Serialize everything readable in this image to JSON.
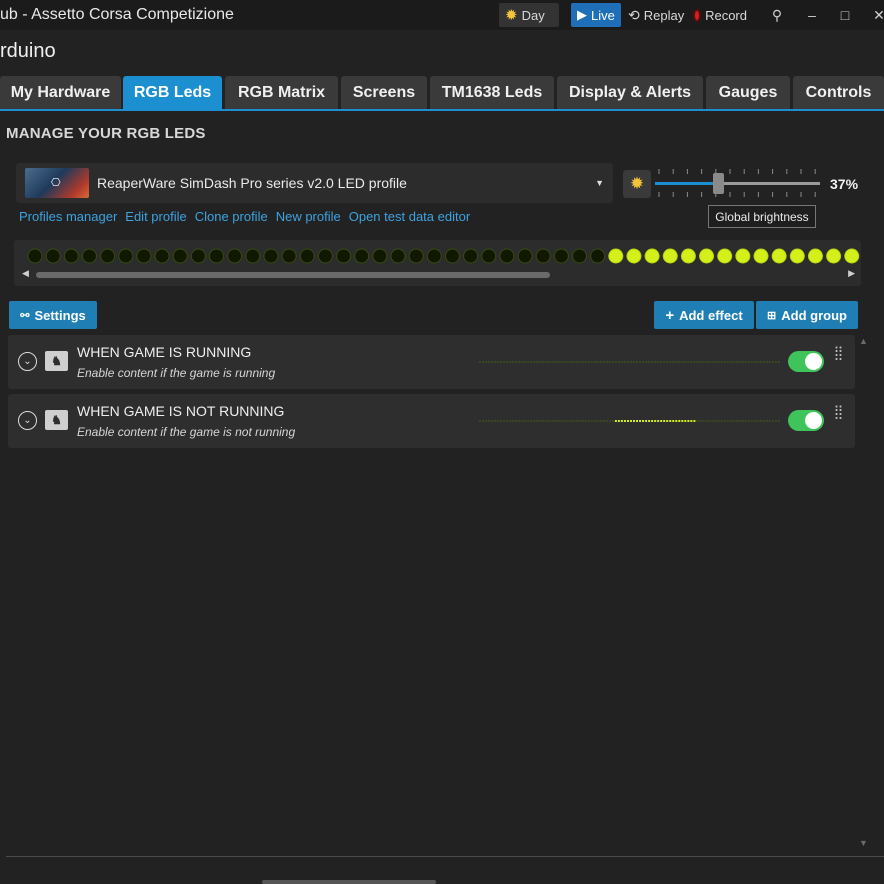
{
  "app": {
    "title": "ub - Assetto Corsa Competizione",
    "device": "rduino"
  },
  "toolbar": {
    "day_label": "Day",
    "live_label": "Live",
    "replay_label": "Replay",
    "record_label": "Record",
    "colors": {
      "live_bg": "#1f6fb8",
      "record_dot": "#d62020",
      "sun": "#f3c43c"
    }
  },
  "tabs": [
    {
      "label": "My Hardware",
      "active": false
    },
    {
      "label": "RGB Leds",
      "active": true
    },
    {
      "label": "RGB Matrix",
      "active": false
    },
    {
      "label": "Screens",
      "active": false
    },
    {
      "label": "TM1638 Leds",
      "active": false
    },
    {
      "label": "Display & Alerts",
      "active": false
    },
    {
      "label": "Gauges",
      "active": false
    },
    {
      "label": "Controls",
      "active": false
    }
  ],
  "section_title": "MANAGE YOUR RGB LEDS",
  "profile": {
    "name": "ReaperWare SimDash Pro series v2.0 LED profile"
  },
  "brightness": {
    "value_text": "37%",
    "fraction": 0.37,
    "tooltip": "Global brightness"
  },
  "profile_links": [
    "Profiles manager",
    "Edit profile",
    "Clone profile",
    "New profile",
    "Open test data editor"
  ],
  "leds": {
    "off_count": 32,
    "on_count": 14,
    "off_color": "#101800",
    "on_color": "#d4f01a"
  },
  "buttons": {
    "settings": "Settings",
    "add_effect": "Add effect",
    "add_group": "Add group"
  },
  "groups": [
    {
      "title": "WHEN GAME IS RUNNING",
      "subtitle": "Enable content if the game is running",
      "enabled": true,
      "lit_from": 0,
      "lit_count": 0
    },
    {
      "title": "WHEN GAME IS NOT RUNNING",
      "subtitle": "Enable content if the game is not running",
      "enabled": true,
      "lit_from": 0.45,
      "lit_count": 0.27
    }
  ]
}
